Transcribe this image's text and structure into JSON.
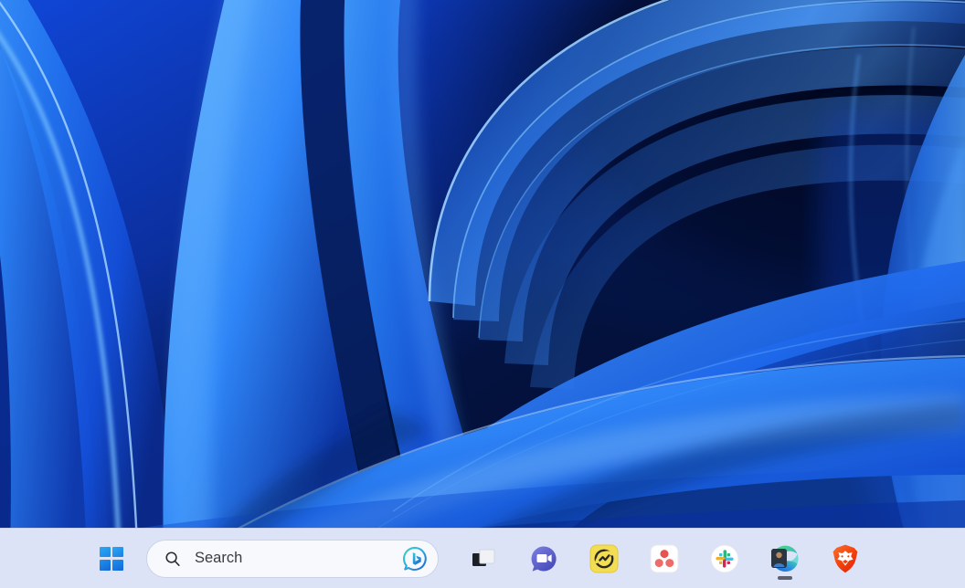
{
  "os": "Windows 11",
  "desktop": {
    "wallpaper_name": "bloom-abstract-blue-ribbons",
    "icons": []
  },
  "colors": {
    "taskbar_bg": "#dde3f6",
    "taskbar_border": "#c8d1ea",
    "search_bg": "#f8f9fd",
    "search_border": "#ccd3e8",
    "search_text": "#3b3b40",
    "wallpaper_deep_navy": "#020a24",
    "wallpaper_mid_blue": "#1652e0",
    "wallpaper_bright_blue": "#2f86f7",
    "accent_blue": "#0f6cbd",
    "start_logo_blue": "#1b86e8",
    "brave_orange": "#f14a0b",
    "asana_red": "#f06a6a",
    "teams_purple": "#5b5fc7",
    "edge_teal": "#35c1b5",
    "yellow_app": "#f5e05a",
    "run_indicator": "#5b6070"
  },
  "taskbar": {
    "start": {
      "label": "Start",
      "icon": "windows-logo-icon"
    },
    "search": {
      "placeholder": "Search",
      "value": "",
      "icon": "search-icon",
      "chat_icon": "bing-chat-icon",
      "chat_label": "Chat with Bing"
    },
    "items": [
      {
        "id": "task-view",
        "label": "Task view",
        "icon": "task-view-icon",
        "running": false,
        "pinned": true
      },
      {
        "id": "chat",
        "label": "Chat",
        "icon": "teams-chat-icon",
        "running": false,
        "pinned": true
      },
      {
        "id": "yellow-app",
        "label": "Loom",
        "icon": "loom-icon",
        "running": false,
        "pinned": true
      },
      {
        "id": "asana",
        "label": "Asana",
        "icon": "asana-icon",
        "running": false,
        "pinned": true
      },
      {
        "id": "slack",
        "label": "Slack",
        "icon": "slack-icon",
        "running": false,
        "pinned": true
      },
      {
        "id": "edge",
        "label": "Microsoft Edge",
        "icon": "microsoft-edge-icon",
        "running": true,
        "pinned": true,
        "has_badge": true
      },
      {
        "id": "brave",
        "label": "Brave",
        "icon": "brave-lion-icon",
        "running": false,
        "pinned": true
      }
    ]
  }
}
